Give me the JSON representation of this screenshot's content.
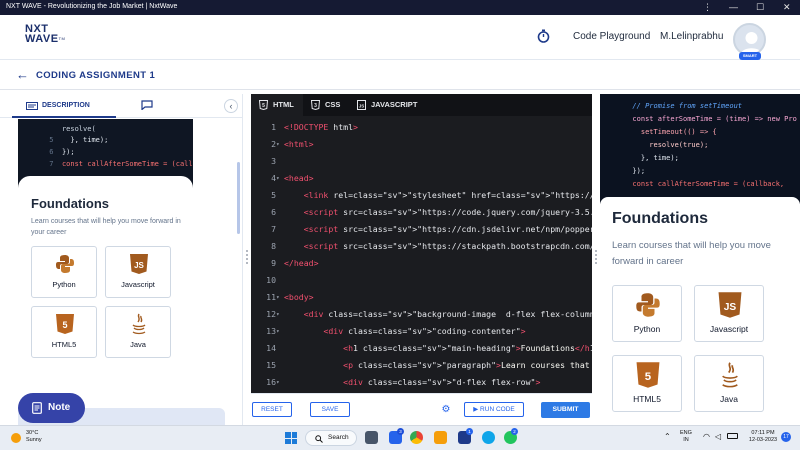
{
  "window": {
    "title": "NXT WAVE - Revolutionizing the Job Market | NxtWave",
    "controls": [
      "⋮",
      "—",
      "☐",
      "✕"
    ]
  },
  "header": {
    "logo_line1": "NXT",
    "logo_line2": "WAVE",
    "logo_tm": "TM",
    "code_playground": "Code Playground",
    "username": "M.Lelinprabhu",
    "badge": "SMART"
  },
  "assignment": {
    "back_icon": "←",
    "title": "CODING ASSIGNMENT 1"
  },
  "left_panel": {
    "tab_description": "DESCRIPTION",
    "collapse_icon": "‹",
    "code_lines": [
      {
        "num": "",
        "text": "  resolve("
      },
      {
        "num": "5",
        "text": "  }, time);"
      },
      {
        "num": "6",
        "text": "});"
      },
      {
        "num": "7",
        "text": "const callAfterSomeTime = (callb"
      }
    ],
    "card_heading": "Foundations",
    "card_text": "Learn courses that will help you move forward in your career",
    "tiles": [
      {
        "label": "Python",
        "icon": "python-icon"
      },
      {
        "label": "Javascript",
        "icon": "javascript-icon"
      },
      {
        "label": "HTML5",
        "icon": "html5-icon"
      },
      {
        "label": "Java",
        "icon": "java-icon"
      }
    ],
    "note_label": "Note"
  },
  "editor": {
    "tabs": [
      {
        "label": "HTML",
        "active": true
      },
      {
        "label": "CSS",
        "active": false
      },
      {
        "label": "JAVASCRIPT",
        "active": false
      }
    ],
    "line_numbers": [
      "1",
      "2",
      "3",
      "4",
      "5",
      "6",
      "7",
      "8",
      "9",
      "10",
      "11",
      "12",
      "13",
      "14",
      "15",
      "16",
      "17"
    ],
    "fold_markers": [
      "",
      "▾",
      "",
      "▾",
      "",
      "",
      "",
      "",
      "",
      "",
      "▾",
      "▾",
      "▾",
      "",
      "",
      "▾",
      ""
    ],
    "lines": [
      "<!DOCTYPE html>",
      "<html>",
      "",
      "<head>",
      "    <link rel=\"stylesheet\" href=\"https://stackpath.bootstr",
      "    <script src=\"https://code.jquery.com/jquery-3.5.1.slim",
      "    <script src=\"https://cdn.jsdelivr.net/npm/popper.js@1.",
      "    <script src=\"https://stackpath.bootstrapcdn.com/bootst",
      "</head>",
      "",
      "<body>",
      "    <div class=\"background-image  d-flex flex-column justi",
      "        <div class=\"coding-contenter\">",
      "            <h1 class=\"main-heading\">Foundations</h1>",
      "            <p class=\"paragraph\">Learn courses that will h",
      "            <div class=\"d-flex flex-row\">",
      "                <div class=\"coding-contenter\">"
    ],
    "buttons": {
      "reset": "RESET",
      "save": "SAVE",
      "run_code": "▶ RUN CODE",
      "submit": "SUBMIT"
    }
  },
  "preview": {
    "code_lines": [
      {
        "num": "",
        "text": "  // Promise from setTimeout"
      },
      {
        "num": "",
        "text": "  const afterSomeTime = (time) => new Pro"
      },
      {
        "num": "",
        "text": "    setTimeout(() => {"
      },
      {
        "num": "",
        "text": "      resolve(true);"
      },
      {
        "num": "",
        "text": "    }, time);"
      },
      {
        "num": "",
        "text": "  });"
      },
      {
        "num": "",
        "text": "  const callAfterSomeTime = (callback,"
      }
    ],
    "heading": "Foundations",
    "text": "Learn courses that will help you move forward in career",
    "tiles": [
      {
        "label": "Python",
        "icon": "python-icon"
      },
      {
        "label": "Javascript",
        "icon": "javascript-icon"
      },
      {
        "label": "HTML5",
        "icon": "html5-icon"
      },
      {
        "label": "Java",
        "icon": "java-icon"
      }
    ]
  },
  "taskbar": {
    "temperature": "30°C",
    "weather": "Sunny",
    "search": "Search",
    "lang_line1": "ENG",
    "lang_line2": "IN",
    "time": "07:11 PM",
    "date": "12-03-2023",
    "notification_count": "17",
    "app_badges": [
      "3",
      "2",
      "1"
    ]
  },
  "colors": {
    "brand_blue": "#1e3a8a",
    "note_button": "#3543a8",
    "submit": "#2d7ae5",
    "editor_bg": "#1b1c20",
    "html_tag": "#f0506e",
    "string": "#e6db74"
  }
}
